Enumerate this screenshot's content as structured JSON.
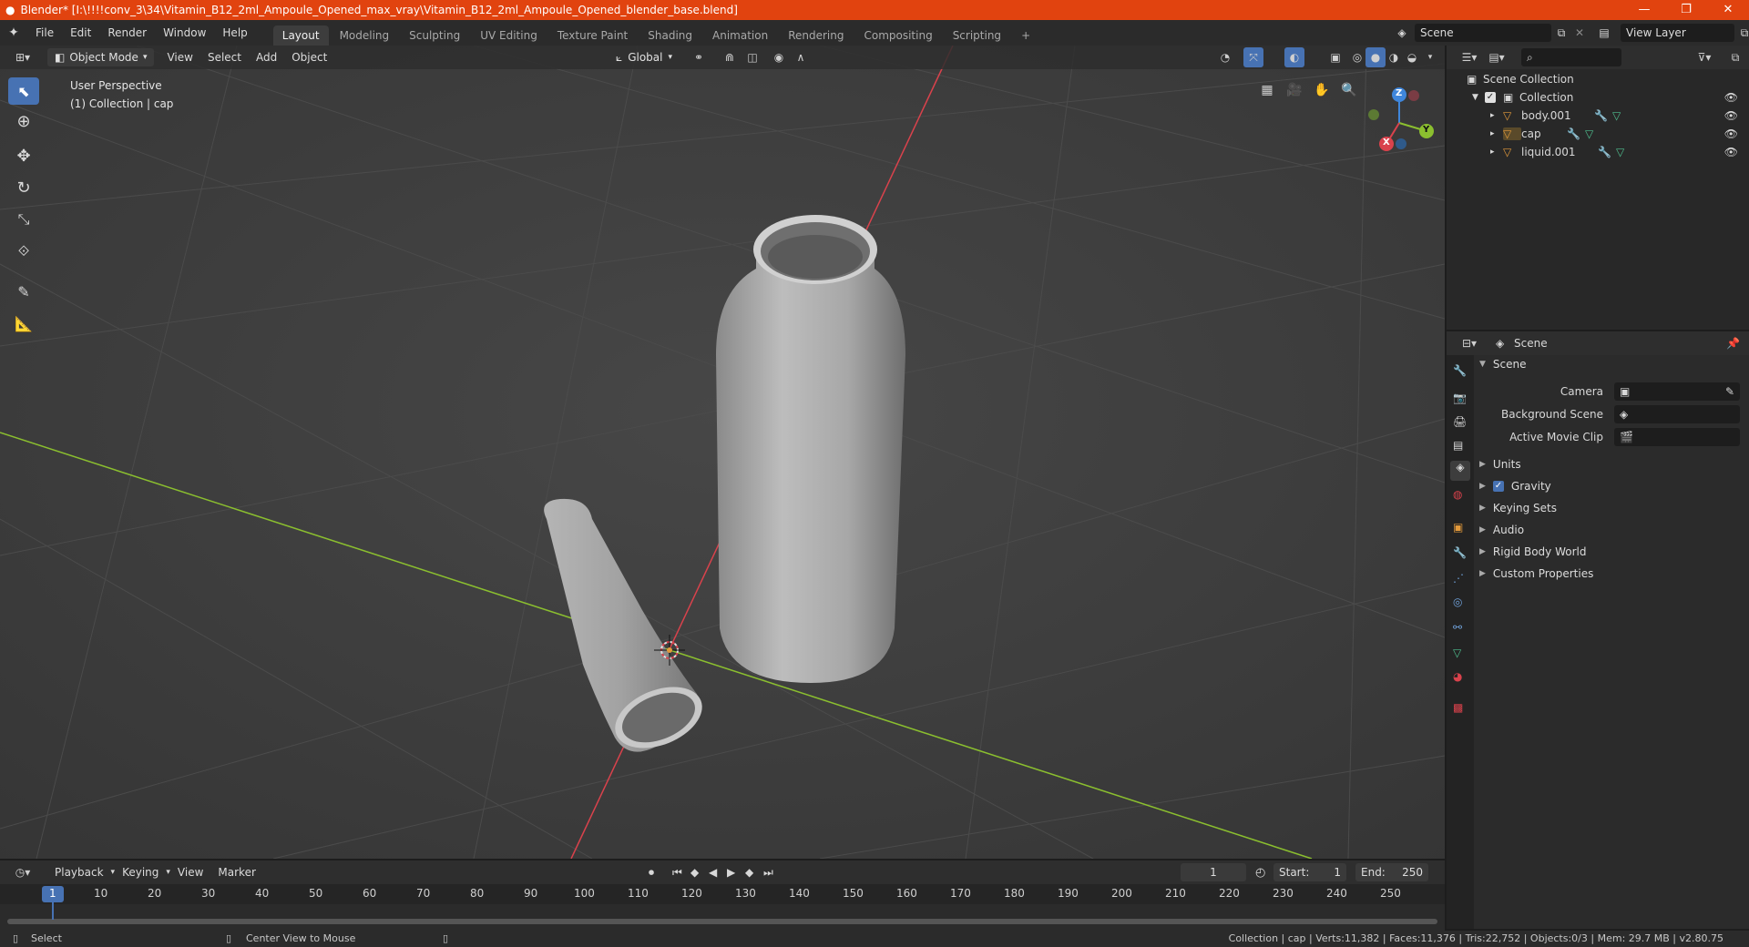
{
  "window": {
    "title": "Blender* [I:\\!!!!conv_3\\34\\Vitamin_B12_2ml_Ampoule_Opened_max_vray\\Vitamin_B12_2ml_Ampoule_Opened_blender_base.blend]",
    "minimize": "—",
    "restore": "❐",
    "close": "✕"
  },
  "menu": [
    "File",
    "Edit",
    "Render",
    "Window",
    "Help"
  ],
  "workspaces": [
    "Layout",
    "Modeling",
    "Sculpting",
    "UV Editing",
    "Texture Paint",
    "Shading",
    "Animation",
    "Rendering",
    "Compositing",
    "Scripting"
  ],
  "workspace_add": "+",
  "scene_field": "Scene",
  "view_layer_field": "View Layer",
  "viewport": {
    "mode": "Object Mode",
    "menus": [
      "View",
      "Select",
      "Add",
      "Object"
    ],
    "orientation": "Global",
    "info_line1": "User Perspective",
    "info_line2": "(1) Collection | cap",
    "gizmo_z": "Z",
    "gizmo_y": "Y",
    "gizmo_x": "X"
  },
  "outliner": {
    "search_icon": "⌕",
    "root": "Scene Collection",
    "collection": "Collection",
    "objects": [
      "body.001",
      "cap",
      "liquid.001"
    ]
  },
  "properties": {
    "context_label": "Scene",
    "panel_scene": "Scene",
    "camera_label": "Camera",
    "background_scene_label": "Background Scene",
    "active_movie_clip_label": "Active Movie Clip",
    "panels": [
      "Units",
      "Gravity",
      "Keying Sets",
      "Audio",
      "Rigid Body World",
      "Custom Properties"
    ]
  },
  "timeline": {
    "menus": [
      "Playback",
      "Keying",
      "View",
      "Marker"
    ],
    "current_frame": "1",
    "start_label": "Start:",
    "start_value": "1",
    "end_label": "End:",
    "end_value": "250",
    "ticks": [
      "1",
      "10",
      "20",
      "30",
      "40",
      "50",
      "60",
      "70",
      "80",
      "90",
      "100",
      "110",
      "120",
      "130",
      "140",
      "150",
      "160",
      "170",
      "180",
      "190",
      "200",
      "210",
      "220",
      "230",
      "240",
      "250"
    ]
  },
  "status": {
    "left_action": "Select",
    "middle_action": "Center View to Mouse",
    "stats": "Collection | cap | Verts:11,382 | Faces:11,376 | Tris:22,752 | Objects:0/3 | Mem: 29.7 MB | v2.80.75"
  },
  "colors": {
    "titlebar": "#e1430f",
    "accent": "#4772b3",
    "x_axis": "#d9424c",
    "y_axis": "#8bbf2f",
    "z_axis": "#3f86db",
    "object_orange": "#e39a3b"
  }
}
